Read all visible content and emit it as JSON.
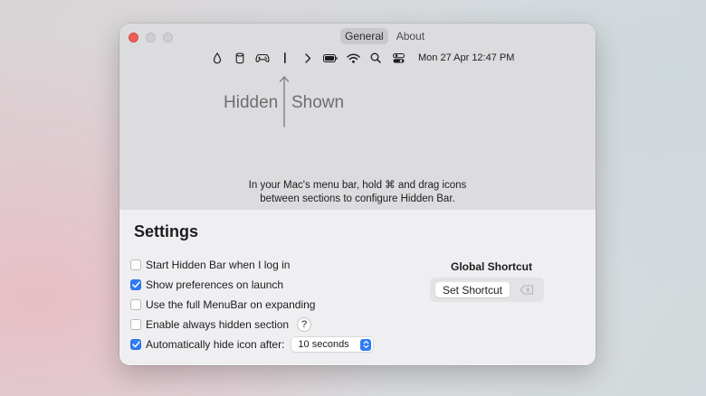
{
  "window": {
    "tabs": [
      {
        "label": "General",
        "active": true
      },
      {
        "label": "About",
        "active": false
      }
    ]
  },
  "menubar": {
    "icons": [
      "drop-icon",
      "cylinder-icon",
      "gamepad-icon",
      "separator-bar-icon",
      "chevron-right-icon",
      "battery-icon",
      "wifi-icon",
      "search-icon",
      "control-center-icon"
    ],
    "clock": "Mon 27 Apr 12:47 PM"
  },
  "diagram": {
    "hidden_label": "Hidden",
    "shown_label": "Shown"
  },
  "info": {
    "line1": "In your Mac's menu bar, hold ⌘ and drag icons",
    "line2": "between sections to configure Hidden Bar."
  },
  "settings": {
    "title": "Settings",
    "options": [
      {
        "label": "Start Hidden Bar when I log in",
        "checked": false
      },
      {
        "label": "Show preferences on launch",
        "checked": true
      },
      {
        "label": "Use the full MenuBar on expanding",
        "checked": false
      },
      {
        "label": "Enable always hidden section",
        "checked": false
      },
      {
        "label": "Automatically hide icon after:",
        "checked": true
      }
    ],
    "help_label": "?",
    "hide_after_value": "10 seconds"
  },
  "shortcut": {
    "title": "Global Shortcut",
    "button_label": "Set Shortcut"
  },
  "colors": {
    "accent": "#2e7cf6",
    "close": "#ec5f57"
  }
}
